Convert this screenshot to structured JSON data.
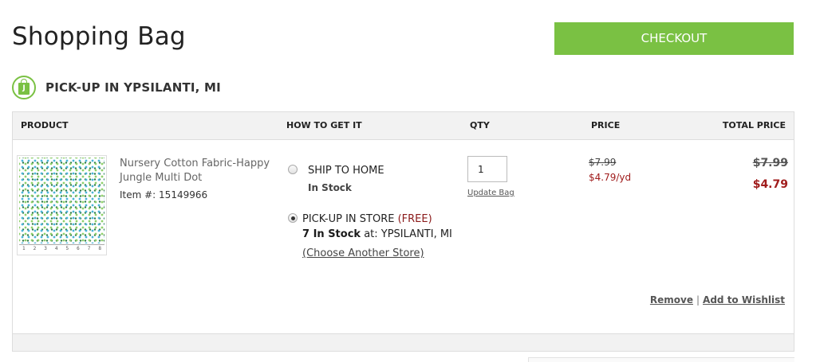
{
  "page": {
    "title": "Shopping Bag"
  },
  "header": {
    "checkout_label": "CHECKOUT"
  },
  "pickup_section": {
    "icon": "shopping-bag-icon",
    "icon_letter": "J",
    "title": "PICK-UP IN YPSILANTI, MI"
  },
  "table": {
    "headers": {
      "product": "PRODUCT",
      "how": "HOW TO GET IT",
      "qty": "QTY",
      "price": "PRICE",
      "total": "TOTAL PRICE"
    }
  },
  "item": {
    "name": "Nursery Cotton Fabric-Happy Jungle Multi Dot",
    "item_number": "Item #: 15149966",
    "ruler_marks": [
      "1",
      "2",
      "3",
      "4",
      "5",
      "6",
      "7",
      "8"
    ],
    "ship_to_home": {
      "label": "SHIP TO HOME",
      "stock": "In Stock",
      "selected": false
    },
    "pickup_in_store": {
      "label": "PICK-UP IN STORE",
      "free_label": "(FREE)",
      "stock_count": "7 In Stock",
      "stock_location": "at: YPSILANTI, MI",
      "choose_store": "(Choose Another Store)",
      "selected": true
    },
    "quantity": "1",
    "update_label": "Update Bag",
    "price_original": "$7.99",
    "price_sale": "$4.79/yd",
    "total_original": "$7.99",
    "total_sale": "$4.79",
    "remove_label": "Remove",
    "separator": "|",
    "wishlist_label": "Add to Wishlist"
  },
  "colors": {
    "accent_green": "#7ac143",
    "sale_red": "#a01c1c",
    "free_red": "#8b1a1a"
  }
}
